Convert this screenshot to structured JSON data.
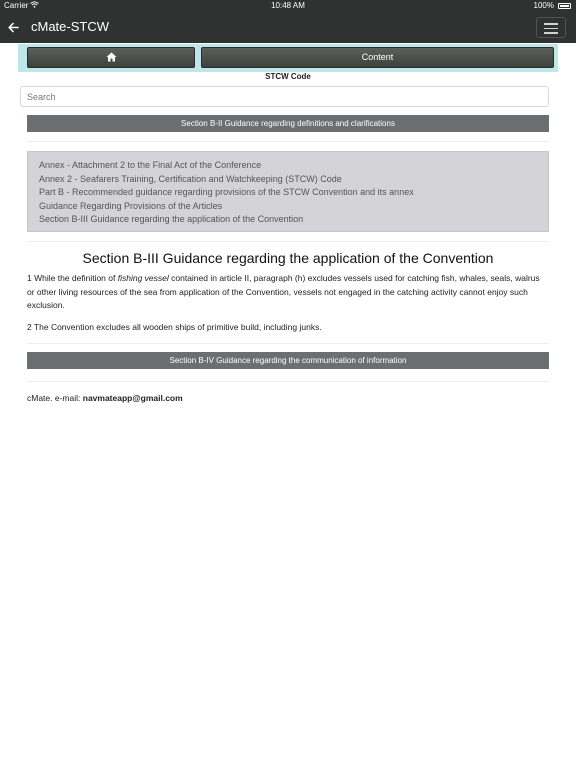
{
  "status_bar": {
    "carrier": "Carrier",
    "time": "10:48 AM",
    "battery": "100%"
  },
  "nav": {
    "title": "cMate-STCW",
    "back_icon": "arrow-left-icon",
    "menu_icon": "hamburger-menu-icon"
  },
  "toolbar": {
    "home_icon": "home-icon",
    "content_label": "Content"
  },
  "code_label": "STCW Code",
  "search": {
    "placeholder": "Search",
    "value": ""
  },
  "prev_section": "Section B-II Guidance regarding definitions and clarifications",
  "breadcrumbs": [
    "Annex - Attachment 2 to the Final Act of the Conference",
    "Annex 2 - Seafarers Training, Certification and Watchkeeping (STCW) Code",
    "Part B - Recommended guidance regarding provisions of the STCW Convention and its annex",
    "Guidance Regarding Provisions of the Articles",
    "Section B-III Guidance regarding the application of the Convention"
  ],
  "section_title": "Section B-III Guidance regarding the application of the Convention",
  "paragraphs": {
    "p1_before": "1 While the definition of ",
    "p1_italic": "fishing vessel",
    "p1_after": " contained in article II, paragraph (h) excludes vessels used for catching fish, whales, seals, walrus or other living resources of the sea from application of the Convention, vessels not engaged in the catching activity cannot enjoy such exclusion.",
    "p2": "2 The Convention excludes all wooden ships of primitive build, including junks."
  },
  "next_section": "Section B-IV Guidance regarding the communication of information",
  "footer": {
    "prefix": "cMate. e-mail: ",
    "email": "navmateapp@gmail.com"
  },
  "colors": {
    "navbar": "#2f3230",
    "toolbar_bg": "#bfe7e9",
    "section_bar": "#6c6f70",
    "breadcrumb_bg": "#d4d4d8"
  }
}
